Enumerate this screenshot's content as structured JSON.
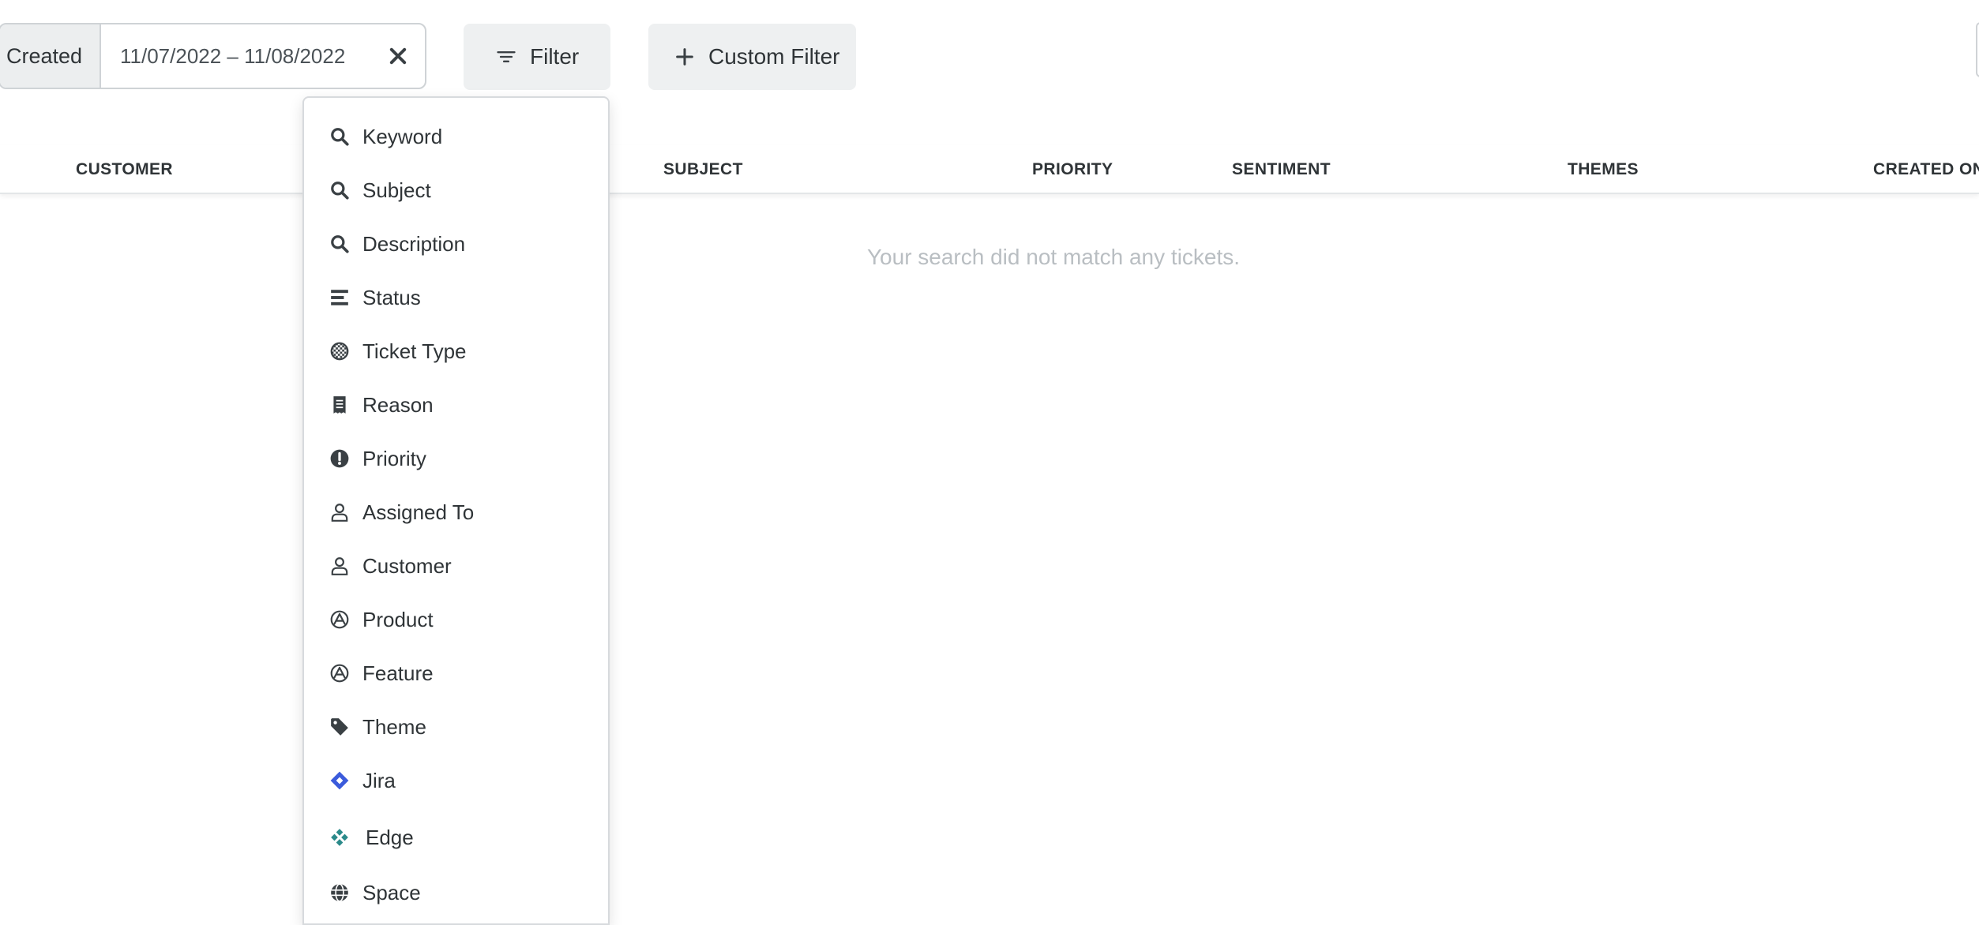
{
  "toolbar": {
    "date_label": "Created",
    "date_range": "11/07/2022 – 11/08/2022",
    "filter_label": "Filter",
    "custom_filter_label": "Custom Filter"
  },
  "table": {
    "columns": [
      "CUSTOMER",
      "SUBJECT",
      "PRIORITY",
      "SENTIMENT",
      "THEMES",
      "CREATED ON"
    ],
    "empty_message": "Your search did not match any tickets."
  },
  "filter_menu": {
    "items": [
      {
        "label": "Keyword",
        "icon": "search-icon"
      },
      {
        "label": "Subject",
        "icon": "search-icon"
      },
      {
        "label": "Description",
        "icon": "search-icon"
      },
      {
        "label": "Status",
        "icon": "bars-icon"
      },
      {
        "label": "Ticket Type",
        "icon": "checkered-circle-icon"
      },
      {
        "label": "Reason",
        "icon": "receipt-icon"
      },
      {
        "label": "Priority",
        "icon": "exclamation-circle-icon"
      },
      {
        "label": "Assigned To",
        "icon": "user-icon"
      },
      {
        "label": "Customer",
        "icon": "user-icon"
      },
      {
        "label": "Product",
        "icon": "product-icon"
      },
      {
        "label": "Feature",
        "icon": "feature-icon"
      },
      {
        "label": "Theme",
        "icon": "tag-icon"
      },
      {
        "label": "Jira",
        "icon": "jira-icon"
      },
      {
        "label": "Edge",
        "icon": "edge-icon"
      },
      {
        "label": "Space",
        "icon": "globe-icon"
      }
    ]
  },
  "colors": {
    "text": "#2f3437",
    "muted": "#b9bec2",
    "button_bg": "#eef0f1",
    "jira_blue": "#3b5bdb",
    "edge_teal": "#2b8a8a"
  }
}
